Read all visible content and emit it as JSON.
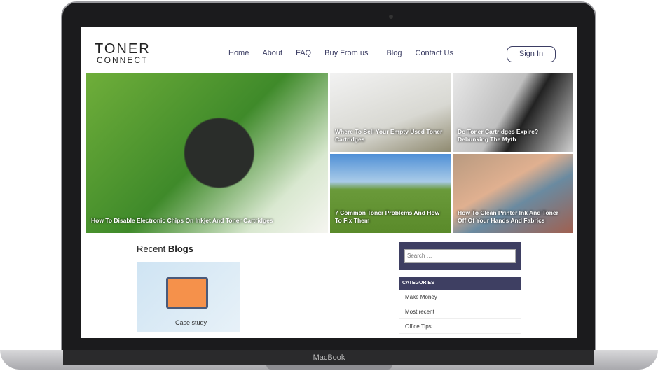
{
  "device": {
    "brand": "MacBook"
  },
  "logo": {
    "line1": "TONER",
    "line2": "CONNECT"
  },
  "nav": [
    "Home",
    "About",
    "FAQ",
    "Buy From us",
    "Blog",
    "Contact Us"
  ],
  "sign_in": "Sign In",
  "featured": [
    {
      "title": "How To Disable Electronic Chips On Inkjet And Toner Cartridges"
    },
    {
      "title": "Where To Sell Your Empty Used Toner Cartridges"
    },
    {
      "title": "Do Toner Cartridges Expire? Debunking The Myth"
    },
    {
      "title": "7 Common Toner Problems And How To Fix Them"
    },
    {
      "title": "How To Clean Printer Ink And Toner Off Of Your Hands And Fabrics"
    }
  ],
  "recent": {
    "prefix": "Recent ",
    "bold": "Blogs",
    "thumb_label": "Case study"
  },
  "sidebar": {
    "search_placeholder": "Search …",
    "categories_title": "CATEGORIES",
    "categories": [
      "Make Money",
      "Most recent",
      "Office Tips"
    ]
  },
  "colors": {
    "navy": "#3e3f62",
    "nav_text": "#3b3d63"
  }
}
